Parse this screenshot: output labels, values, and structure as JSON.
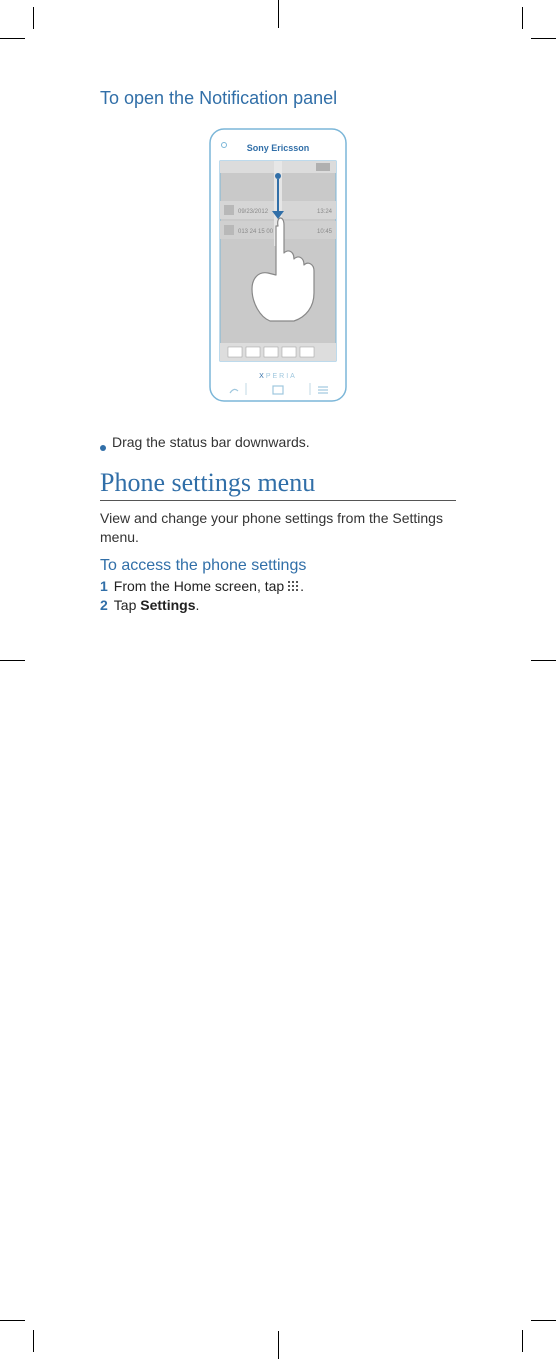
{
  "heading1": "To open the Notification panel",
  "figure": {
    "brand": "Sony Ericsson",
    "sub_brand": "XPERIA",
    "notifications": [
      {
        "text": "09/23/2012",
        "time": "13:24"
      },
      {
        "text": "013 24 15 00",
        "time": "10:45"
      }
    ]
  },
  "bullet": "Drag the status bar downwards.",
  "section_title": "Phone settings menu",
  "section_intro": "View and change your phone settings from the Settings menu.",
  "heading2": "To access the phone settings",
  "steps": [
    {
      "num": "1",
      "text_before": "From the Home screen, tap ",
      "text_after": "."
    },
    {
      "num": "2",
      "text_before": "Tap ",
      "bold": "Settings",
      "text_after": "."
    }
  ]
}
